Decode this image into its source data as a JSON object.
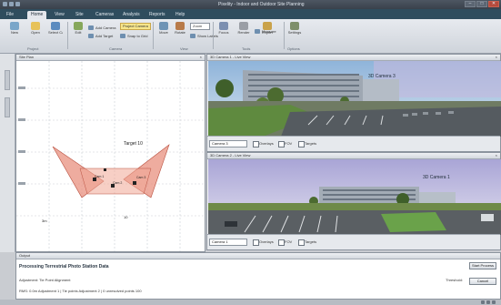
{
  "app": {
    "title": "Pixelity - Indoor and Outdoor Site Planning",
    "window_buttons": [
      "–",
      "□",
      "✕"
    ]
  },
  "tabs": [
    "File",
    "Home",
    "View",
    "Site",
    "Cameras",
    "Analysis",
    "Reports",
    "Help"
  ],
  "ribbon": {
    "buttons": [
      {
        "label": "New",
        "color": "#7aa6c9"
      },
      {
        "label": "Open",
        "color": "#e7c25a"
      },
      {
        "label": "Select Camera",
        "color": "#5b8bbf"
      },
      {
        "label": "Edit",
        "color": "#86a75b"
      },
      {
        "label": "Move",
        "color": "#6f94b5"
      },
      {
        "label": "Rotate",
        "color": "#b87b4a"
      },
      {
        "label": "Focus",
        "color": "#7c8fb0"
      },
      {
        "label": "Zoom",
        "color": "#5f7fa8"
      },
      {
        "label": "Render",
        "color": "#9a9ea5"
      },
      {
        "label": "Export",
        "color": "#c9a24a"
      },
      {
        "label": "Settings",
        "color": "#7e8f6a"
      }
    ],
    "project_select": "Project Camera",
    "small_items": [
      "Add Camera",
      "Add Target",
      "Snap to Grid",
      "Show Labels",
      "Measure"
    ],
    "group_labels": [
      "Project",
      "Camera",
      "View",
      "Tools",
      "Options"
    ]
  },
  "plan_panel": {
    "title": "Site Plan",
    "labels": {
      "target": "Target 10",
      "cam_a": "Cam 1",
      "cam_b": "Cam 2",
      "cam_c": "Cam 3",
      "bl": "3m",
      "bc": "10"
    }
  },
  "camera_views": [
    {
      "title": "3D Camera 1 - Live View",
      "overlay": "3D Camera 3",
      "select": "Camera 3",
      "checks": [
        "Overlays",
        "FOV",
        "Targets"
      ]
    },
    {
      "title": "3D Camera 2 - Live View",
      "overlay": "3D Camera 1",
      "select": "Camera 1",
      "checks": [
        "Overlays",
        "FOV",
        "Targets"
      ]
    }
  ],
  "status": {
    "panel_title": "Output",
    "line1": "Processing Terrestrial Photo Station Data",
    "line2": "Adjustment: Tie Point Alignment",
    "line3": "RMS: 0.0m Adjustment 1 | Tie points Adjustment 2 | 0 unresolved points 100",
    "threshold_label": "Threshold:",
    "button1": "Start Process",
    "button2": "Cancel"
  }
}
